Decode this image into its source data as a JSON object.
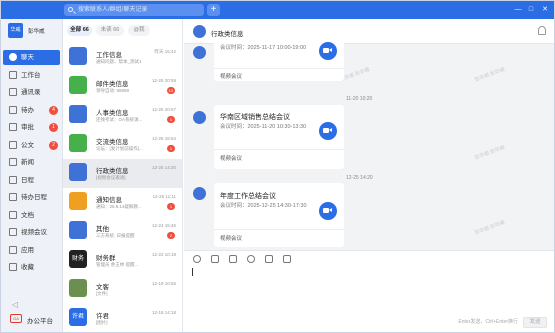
{
  "titlebar": {
    "search_placeholder": "搜索联系人/群组/聊天记录",
    "plus_label": "+",
    "min_label": "—",
    "max_label": "□",
    "close_label": "✕"
  },
  "brand": {
    "logo_text": "华威",
    "user_name": "彭华威"
  },
  "nav": {
    "items": [
      {
        "label": "聊天",
        "badge": ""
      },
      {
        "label": "工作台",
        "badge": ""
      },
      {
        "label": "通讯录",
        "badge": ""
      },
      {
        "label": "待办",
        "badge": "4"
      },
      {
        "label": "审批",
        "badge": "1"
      },
      {
        "label": "公文",
        "badge": "2"
      },
      {
        "label": "新闻",
        "badge": ""
      },
      {
        "label": "日程",
        "badge": ""
      },
      {
        "label": "待办日程",
        "badge": ""
      },
      {
        "label": "文档",
        "badge": ""
      },
      {
        "label": "视频会议",
        "badge": ""
      },
      {
        "label": "应用",
        "badge": ""
      },
      {
        "label": "收藏",
        "badge": ""
      }
    ],
    "collapse_label": "◁",
    "office_label": "办公平台",
    "office_icon_text": "OA"
  },
  "filters": [
    {
      "label": "全部 66"
    },
    {
      "label": "未读 66"
    },
    {
      "label": "@我"
    }
  ],
  "conversations": [
    {
      "title": "工作信息",
      "time": "昨天 15:42",
      "preview": "通知问题、帮本_测试1",
      "badge": "",
      "avatar_color": "#3e72d6",
      "avatar_text": ""
    },
    {
      "title": "邮件类信息",
      "time": "12-25 20:59",
      "preview": "领导自动: 88888",
      "badge": "10",
      "avatar_color": "#46b04a",
      "avatar_text": ""
    },
    {
      "title": "人事类信息",
      "time": "12-25 20:57",
      "preview": "还钱考试：OA系统请...",
      "badge": "1",
      "avatar_color": "#3e72d6",
      "avatar_text": ""
    },
    {
      "title": "交流类信息",
      "time": "12-25 18:54",
      "preview": "论坛：[发计划前操作]...",
      "badge": "1",
      "avatar_color": "#46b04a",
      "avatar_text": ""
    },
    {
      "title": "行政类信息",
      "time": "12-25 14:20",
      "preview": "[视频会议邀请]",
      "badge": "",
      "avatar_color": "#3e72d6",
      "avatar_text": ""
    },
    {
      "title": "通知信息",
      "time": "12-25 11:11",
      "preview": "通知：25.5.14疑解教...",
      "badge": "1",
      "avatar_color": "#f0a020",
      "avatar_text": ""
    },
    {
      "title": "其他",
      "time": "12-24 15:46",
      "preview": "三方系统: 日报提醒",
      "badge": "2",
      "avatar_color": "#3e72d6",
      "avatar_text": ""
    },
    {
      "title": "财务群",
      "time": "12-22 10:18",
      "preview": "管理员 余王林 提醒...",
      "badge": "",
      "avatar_color": "#222222",
      "avatar_text": "财务"
    },
    {
      "title": "文客",
      "time": "12-19 10:55",
      "preview": "[文件]",
      "badge": "",
      "avatar_color": "#6a8f4e",
      "avatar_text": ""
    },
    {
      "title": "许君",
      "time": "12-18 14:18",
      "preview": "[图片]",
      "badge": "",
      "avatar_color": "#2a6de4",
      "avatar_text": "许君"
    }
  ],
  "chat": {
    "title": "行政类信息",
    "messages": [
      {
        "card_title": "",
        "meeting_time": "会议时间：2025-11-17 10:00-19:00",
        "footer": "视频会议"
      },
      {
        "timestamp": "11-20 10:20",
        "card_title": "华南区域销售总结会议",
        "meeting_time": "会议时间：2025-11-20 10:30-13:30",
        "footer": "视频会议"
      },
      {
        "timestamp": "12-25 14:20",
        "card_title": "年度工作总结会议",
        "meeting_time": "会议时间：2025-12-25 14:30-17:30",
        "footer": "视频会议"
      }
    ],
    "watermark": "彭华威 彭华威",
    "composer_hint": "Enter发送，Ctrl+Enter换行",
    "send_label": "发送"
  }
}
